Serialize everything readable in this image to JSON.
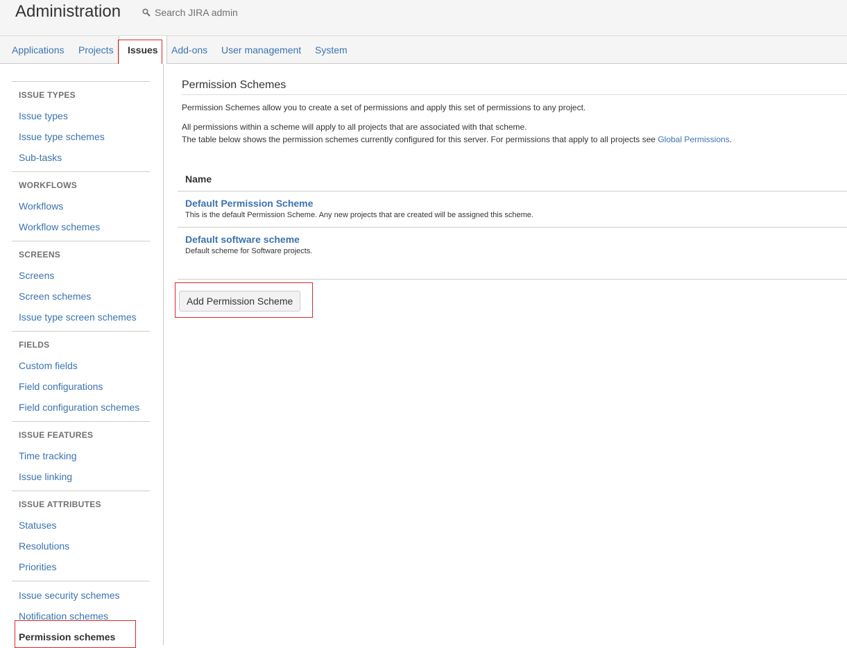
{
  "header": {
    "title": "Administration",
    "search_placeholder": "Search JIRA admin",
    "search_icon": "search-icon"
  },
  "tabs": [
    {
      "label": "Applications"
    },
    {
      "label": "Projects"
    },
    {
      "label": "Issues"
    },
    {
      "label": "Add-ons"
    },
    {
      "label": "User management"
    },
    {
      "label": "System"
    }
  ],
  "sidebar": {
    "issue_types": {
      "heading": "ISSUE TYPES",
      "items": [
        "Issue types",
        "Issue type schemes",
        "Sub-tasks"
      ]
    },
    "workflows": {
      "heading": "WORKFLOWS",
      "items": [
        "Workflows",
        "Workflow schemes"
      ]
    },
    "screens": {
      "heading": "SCREENS",
      "items": [
        "Screens",
        "Screen schemes",
        "Issue type screen schemes"
      ]
    },
    "fields": {
      "heading": "FIELDS",
      "items": [
        "Custom fields",
        "Field configurations",
        "Field configuration schemes"
      ]
    },
    "issue_features": {
      "heading": "ISSUE FEATURES",
      "items": [
        "Time tracking",
        "Issue linking"
      ]
    },
    "issue_attributes": {
      "heading": "ISSUE ATTRIBUTES",
      "items": [
        "Statuses",
        "Resolutions",
        "Priorities"
      ]
    },
    "other": {
      "items": [
        "Issue security schemes",
        "Notification schemes",
        "Permission schemes"
      ]
    }
  },
  "main": {
    "title": "Permission Schemes",
    "desc1": "Permission Schemes allow you to create a set of permissions and apply this set of permissions to any project.",
    "desc2": "All permissions within a scheme will apply to all projects that are associated with that scheme.",
    "desc3": "The table below shows the permission schemes currently configured for this server. For permissions that apply to all projects see",
    "global_link": "Global Permissions",
    "desc3_end": ".",
    "table_header": "Name",
    "schemes": [
      {
        "name": "Default Permission Scheme",
        "description": "This is the default Permission Scheme. Any new projects that are created will be assigned this scheme."
      },
      {
        "name": "Default software scheme",
        "description": "Default scheme for Software projects."
      }
    ],
    "add_button": "Add Permission Scheme"
  },
  "colors": {
    "link": "#3b73af",
    "highlight": "#d9262b"
  }
}
